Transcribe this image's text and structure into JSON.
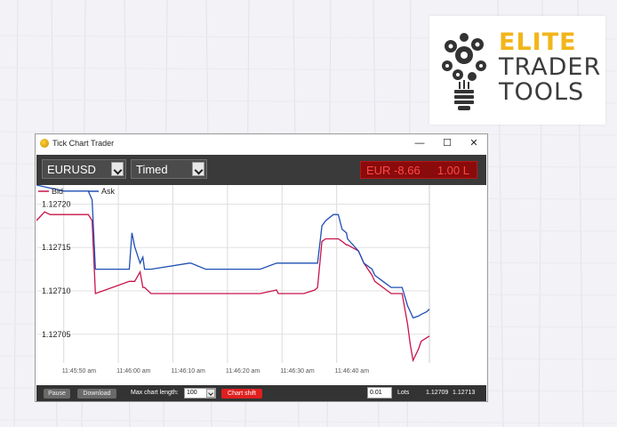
{
  "logo": {
    "line1": "ELITE",
    "line2": "TRADER",
    "line3": "TOOLS",
    "accent_color": "#f2b51b",
    "icon": "lightbulb-gears-icon"
  },
  "window": {
    "title": "Tick Chart Trader",
    "controls": {
      "minimize": "—",
      "maximize": "☐",
      "close": "✕"
    }
  },
  "toolbar": {
    "symbol": "EURUSD",
    "mode": "Timed",
    "pnl_label": "EUR -8.66",
    "pnl_lots": "1.00 L",
    "pnl_color": "#ff4848"
  },
  "statusbar": {
    "pause_label": "Pause",
    "download_label": "Download",
    "max_chart_length_label": "Max chart length:",
    "max_chart_length_value": "100",
    "chart_shift_label": "Chart shift",
    "lots_value": "0.01",
    "lots_label": "Lots",
    "bid_value": "1.12709",
    "ask_value": "1.12713"
  },
  "chart_data": {
    "type": "line",
    "x_tick_labels": [
      "11:45:50 am",
      "11:46:00 am",
      "11:46:10 am",
      "11:46:20 am",
      "11:46:30 am",
      "11:46:40 am"
    ],
    "y_tick_labels": [
      "1.12720",
      "1.12715",
      "1.12710",
      "1.12705"
    ],
    "ylim": [
      1.127017,
      1.127222
    ],
    "grid": true,
    "legend_position": "top-left",
    "series": [
      {
        "name": "Bid",
        "color": "#c8144a",
        "x": [
          -5,
          -3.5,
          -2.5,
          0,
          3.5,
          4.5,
          5.2,
          5.8,
          12,
          12.5,
          13,
          14,
          14.5,
          14.8,
          16,
          23,
          23.3,
          26,
          36,
          39,
          39.3,
          41,
          42.5,
          44,
          45,
          46,
          46.5,
          47.3,
          48,
          49.4,
          49.6,
          50,
          50.3,
          51,
          51.8,
          52,
          54,
          54.5,
          55,
          56.5,
          57,
          58.5,
          60,
          62,
          63,
          63.5,
          64,
          65,
          65.5,
          66.5,
          67
        ],
        "y": [
          1.127181,
          1.127191,
          1.127188,
          1.127188,
          1.127188,
          1.127188,
          1.127181,
          1.127097,
          1.127111,
          1.127111,
          1.127111,
          1.127122,
          1.127104,
          1.127104,
          1.127097,
          1.127097,
          1.127097,
          1.127097,
          1.127097,
          1.127101,
          1.127097,
          1.127097,
          1.127097,
          1.127097,
          1.127099,
          1.127101,
          1.127104,
          1.127157,
          1.12716,
          1.12716,
          1.12716,
          1.12716,
          1.12716,
          1.127157,
          1.127153,
          1.127153,
          1.127146,
          1.127139,
          1.127132,
          1.127118,
          1.127111,
          1.127104,
          1.127097,
          1.127097,
          1.127062,
          1.127038,
          1.12702,
          1.127033,
          1.127042,
          1.127046,
          1.127048
        ]
      },
      {
        "name": "Ask",
        "color": "#1f4fb4",
        "x": [
          -5,
          0,
          3.5,
          4.5,
          5.2,
          5.8,
          12,
          12.5,
          13,
          14,
          14.5,
          14.8,
          16,
          23,
          23.3,
          26,
          36,
          39,
          39.3,
          41,
          42.5,
          44,
          45,
          46,
          46.5,
          47.3,
          48,
          49.4,
          49.6,
          50,
          50.3,
          51,
          51.8,
          52,
          54,
          54.5,
          55,
          56.5,
          57,
          58.5,
          60,
          62,
          63,
          63.5,
          64,
          65,
          65.5,
          66.5,
          67
        ],
        "y": [
          1.127222,
          1.127215,
          1.127215,
          1.127215,
          1.127205,
          1.127125,
          1.127125,
          1.127167,
          1.127151,
          1.127132,
          1.127139,
          1.127125,
          1.127125,
          1.127132,
          1.127132,
          1.127125,
          1.127125,
          1.127132,
          1.127132,
          1.127132,
          1.127132,
          1.127132,
          1.127132,
          1.127132,
          1.127132,
          1.127175,
          1.127181,
          1.127188,
          1.127188,
          1.127188,
          1.127188,
          1.127171,
          1.127167,
          1.12716,
          1.127146,
          1.127139,
          1.127132,
          1.127125,
          1.127118,
          1.127111,
          1.127104,
          1.127104,
          1.127083,
          1.127076,
          1.127069,
          1.127071,
          1.127073,
          1.127076,
          1.127079
        ]
      }
    ]
  }
}
